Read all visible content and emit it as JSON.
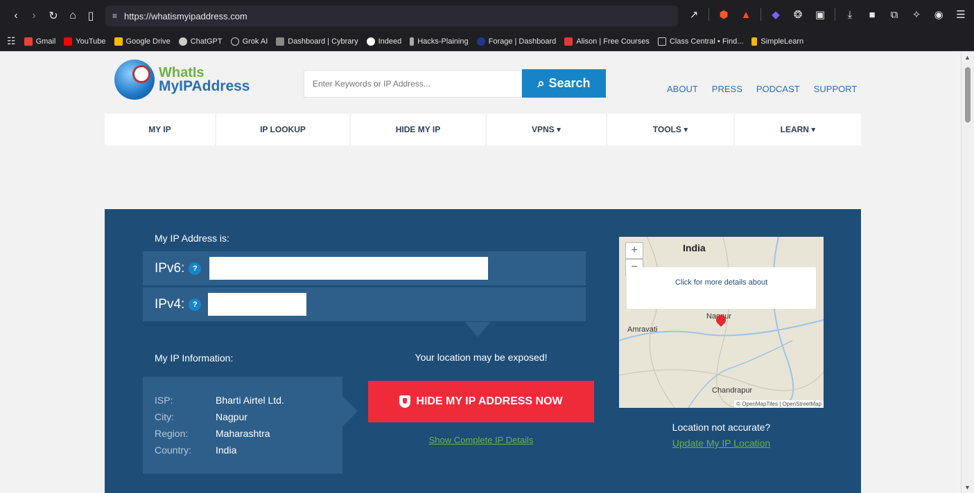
{
  "browser": {
    "url": "https://whatismyipaddress.com",
    "bookmarks": [
      {
        "label": "Gmail",
        "color": "#ea4335"
      },
      {
        "label": "YouTube",
        "color": "#ff0000"
      },
      {
        "label": "Google Drive",
        "color": "#fbbc04"
      },
      {
        "label": "ChatGPT",
        "color": "#cccccc"
      },
      {
        "label": "Grok AI",
        "color": "#cccccc"
      },
      {
        "label": "Dashboard | Cybrary",
        "color": "#888888"
      },
      {
        "label": "Indeed",
        "color": "#ffffff"
      },
      {
        "label": "Hacks-Plaining",
        "color": "#aaaaaa"
      },
      {
        "label": "Forage | Dashboard",
        "color": "#1e3a8a"
      },
      {
        "label": "Alison | Free Courses",
        "color": "#e53935"
      },
      {
        "label": "Class Central • Find...",
        "color": "#cccccc"
      },
      {
        "label": "SimpleLearn",
        "color": "#f5b800"
      }
    ]
  },
  "site": {
    "logo_line1": "WhatIs",
    "logo_line2": "MyIPAddress",
    "search_placeholder": "Enter Keywords or IP Address...",
    "search_label": "Search",
    "toplinks": [
      "ABOUT",
      "PRESS",
      "PODCAST",
      "SUPPORT"
    ],
    "nav": [
      {
        "label": "MY IP"
      },
      {
        "label": "IP LOOKUP"
      },
      {
        "label": "HIDE MY IP"
      },
      {
        "label": "VPNS ▾"
      },
      {
        "label": "TOOLS ▾"
      },
      {
        "label": "LEARN ▾"
      }
    ]
  },
  "hero": {
    "heading": "My IP Address is:",
    "ipv6_label": "IPv6:",
    "ipv4_label": "IPv4:",
    "info_heading": "My IP Information:",
    "info": [
      {
        "key": "ISP:",
        "value": "Bharti Airtel Ltd."
      },
      {
        "key": "City:",
        "value": "Nagpur"
      },
      {
        "key": "Region:",
        "value": "Maharashtra"
      },
      {
        "key": "Country:",
        "value": "India"
      }
    ],
    "exposed_text": "Your location may be exposed!",
    "hide_button": "HIDE MY IP ADDRESS NOW",
    "show_details": "Show Complete IP Details",
    "map": {
      "title": "India",
      "popup": "Click for more details about",
      "cities": [
        "Amravati",
        "Nagpur",
        "Chandrapur"
      ],
      "attribution": "© OpenMapTiles | OpenStreetMap"
    },
    "not_accurate": "Location not accurate?",
    "update_link": "Update My IP Location"
  }
}
